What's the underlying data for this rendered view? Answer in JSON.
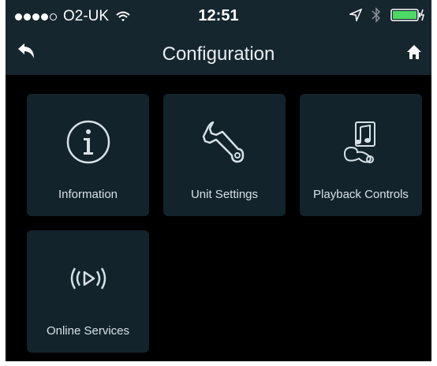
{
  "status": {
    "carrier": "O2-UK",
    "time": "12:51"
  },
  "nav": {
    "title": "Configuration"
  },
  "tiles": [
    {
      "label": "Information"
    },
    {
      "label": "Unit Settings"
    },
    {
      "label": "Playback Controls"
    },
    {
      "label": "Online Services"
    }
  ],
  "colors": {
    "background": "#000000",
    "header": "#16262f",
    "tile": "#12232c",
    "text": "#d7e1e6"
  }
}
